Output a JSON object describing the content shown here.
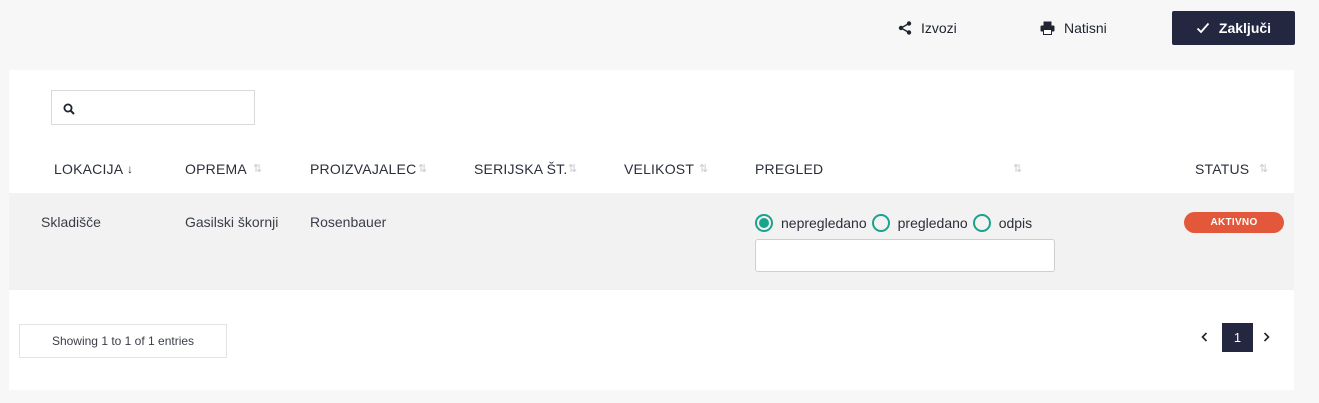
{
  "toolbar": {
    "export_label": "Izvozi",
    "print_label": "Natisni",
    "finish_label": "Zaključi"
  },
  "search": {
    "value": "",
    "placeholder": ""
  },
  "table": {
    "columns": [
      "LOKACIJA",
      "OPREMA",
      "PROIZVAJALEC",
      "SERIJSKA ŠT.",
      "VELIKOST",
      "PREGLED",
      "STATUS"
    ],
    "rows": [
      {
        "lokacija": "Skladišče",
        "oprema": "Gasilski škornji",
        "proizvajalec": "Rosenbauer",
        "serijska": "",
        "velikost": "",
        "pregled_options": [
          "nepregledano",
          "pregledano",
          "odpis"
        ],
        "pregled_selected": "nepregledano",
        "pregled_note": "",
        "status": "AKTIVNO"
      }
    ]
  },
  "footer": {
    "info": "Showing 1 to 1 of 1 entries",
    "current_page": "1"
  },
  "colors": {
    "primary_dark": "#23273f",
    "accent_teal": "#1aa38d",
    "status_active": "#e3573a"
  },
  "icons": [
    "share-icon",
    "printer-icon",
    "check-icon",
    "search-icon",
    "sort-desc-icon",
    "sort-both-icon",
    "chevron-left-icon",
    "chevron-right-icon"
  ]
}
